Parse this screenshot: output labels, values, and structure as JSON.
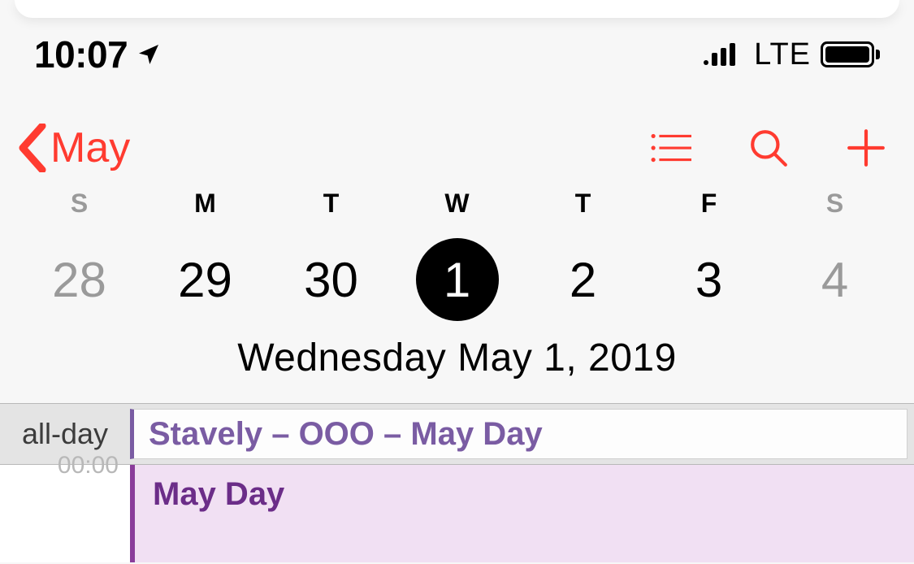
{
  "status": {
    "time": "10:07",
    "network": "LTE"
  },
  "nav": {
    "back_label": "May"
  },
  "weekdays": [
    "S",
    "M",
    "T",
    "W",
    "T",
    "F",
    "S"
  ],
  "dates": [
    {
      "day": "28",
      "faded": true,
      "selected": false
    },
    {
      "day": "29",
      "faded": false,
      "selected": false
    },
    {
      "day": "30",
      "faded": false,
      "selected": false
    },
    {
      "day": "1",
      "faded": false,
      "selected": true
    },
    {
      "day": "2",
      "faded": false,
      "selected": false
    },
    {
      "day": "3",
      "faded": false,
      "selected": false
    },
    {
      "day": "4",
      "faded": true,
      "selected": false
    }
  ],
  "full_date": "Wednesday   May 1, 2019",
  "allday": {
    "label": "all-day",
    "event_title": "Stavely – OOO – May Day"
  },
  "timeline": {
    "time_label": "00:00",
    "event_title": "May Day"
  },
  "colors": {
    "accent": "#ff3b30",
    "event_purple": "#7a5ca3",
    "event_purple_bg": "#f1e0f3"
  }
}
